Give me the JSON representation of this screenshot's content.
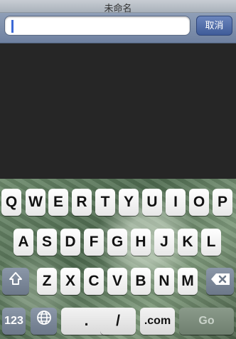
{
  "window": {
    "title": "未命名"
  },
  "search": {
    "value": "",
    "placeholder": ""
  },
  "buttons": {
    "cancel": "取消"
  },
  "keyboard": {
    "row1": [
      "Q",
      "W",
      "E",
      "R",
      "T",
      "Y",
      "U",
      "I",
      "O",
      "P"
    ],
    "row2": [
      "A",
      "S",
      "D",
      "F",
      "G",
      "H",
      "J",
      "K",
      "L"
    ],
    "row3": [
      "Z",
      "X",
      "C",
      "V",
      "B",
      "N",
      "M"
    ],
    "bottom": {
      "numbers": "123",
      "dot": ".",
      "slash": "/",
      "dotcom": ".com",
      "go": "Go"
    },
    "icons": {
      "shift": "shift-arrow-icon",
      "delete": "backspace-icon",
      "globe": "globe-icon"
    }
  }
}
